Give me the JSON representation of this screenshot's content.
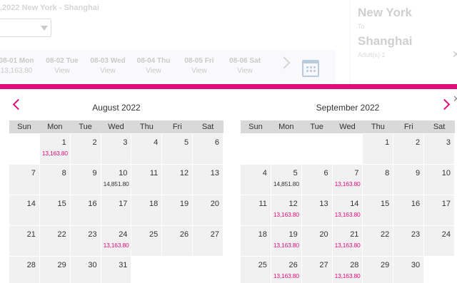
{
  "header": {
    "route_title": ",2022 New York - Shanghai",
    "date_strip": [
      {
        "date": "08-01 Mon",
        "sub": "13,163.80"
      },
      {
        "date": "08-02 Tue",
        "sub": "View"
      },
      {
        "date": "08-03 Wed",
        "sub": "View"
      },
      {
        "date": "08-04 Thu",
        "sub": "View"
      },
      {
        "date": "08-05 Fri",
        "sub": "View"
      },
      {
        "date": "08-06 Sat",
        "sub": "View"
      }
    ]
  },
  "summary": {
    "from": "New York",
    "to_label": "To",
    "destination": "Shanghai",
    "passengers": "Adult(s) 1"
  },
  "weekdays": [
    "Sun",
    "Mon",
    "Tue",
    "Wed",
    "Thu",
    "Fri",
    "Sat"
  ],
  "months": [
    {
      "title": "August 2022",
      "weeks": [
        [
          null,
          {
            "d": "1",
            "p": "13,163.80"
          },
          {
            "d": "2"
          },
          {
            "d": "3"
          },
          {
            "d": "4"
          },
          {
            "d": "5"
          },
          {
            "d": "6"
          }
        ],
        [
          {
            "d": "7"
          },
          {
            "d": "8"
          },
          {
            "d": "9"
          },
          {
            "d": "10",
            "p": "14,851.80",
            "dark": true
          },
          {
            "d": "11"
          },
          {
            "d": "12"
          },
          {
            "d": "13"
          }
        ],
        [
          {
            "d": "14"
          },
          {
            "d": "15"
          },
          {
            "d": "16"
          },
          {
            "d": "17"
          },
          {
            "d": "18"
          },
          {
            "d": "19"
          },
          {
            "d": "20"
          }
        ],
        [
          {
            "d": "21"
          },
          {
            "d": "22"
          },
          {
            "d": "23"
          },
          {
            "d": "24",
            "p": "13,163.80"
          },
          {
            "d": "25"
          },
          {
            "d": "26"
          },
          {
            "d": "27"
          }
        ],
        [
          {
            "d": "28"
          },
          {
            "d": "29"
          },
          {
            "d": "30"
          },
          {
            "d": "31"
          },
          null,
          null,
          null
        ]
      ]
    },
    {
      "title": "September 2022",
      "weeks": [
        [
          null,
          null,
          null,
          null,
          {
            "d": "1"
          },
          {
            "d": "2"
          },
          {
            "d": "3"
          }
        ],
        [
          {
            "d": "4"
          },
          {
            "d": "5",
            "p": "14,851.80",
            "dark": true
          },
          {
            "d": "6"
          },
          {
            "d": "7",
            "p": "13,163.80"
          },
          {
            "d": "8"
          },
          {
            "d": "9"
          },
          {
            "d": "10"
          }
        ],
        [
          {
            "d": "11"
          },
          {
            "d": "12",
            "p": "13,163.80"
          },
          {
            "d": "13"
          },
          {
            "d": "14",
            "p": "13,163.80"
          },
          {
            "d": "15"
          },
          {
            "d": "16"
          },
          {
            "d": "17"
          }
        ],
        [
          {
            "d": "18"
          },
          {
            "d": "19",
            "p": "13,163.80"
          },
          {
            "d": "20"
          },
          {
            "d": "21",
            "p": "13,163.80"
          },
          {
            "d": "22"
          },
          {
            "d": "23"
          },
          {
            "d": "24"
          }
        ],
        [
          {
            "d": "25"
          },
          {
            "d": "26",
            "p": "13,163.80"
          },
          {
            "d": "27"
          },
          {
            "d": "28",
            "p": "13,163.80"
          },
          {
            "d": "29"
          },
          {
            "d": "30"
          },
          null
        ]
      ]
    }
  ],
  "colors": {
    "accent": "#e00d7a",
    "day_bg": "#f1f1f1",
    "header_bg": "#d9d9d9"
  }
}
